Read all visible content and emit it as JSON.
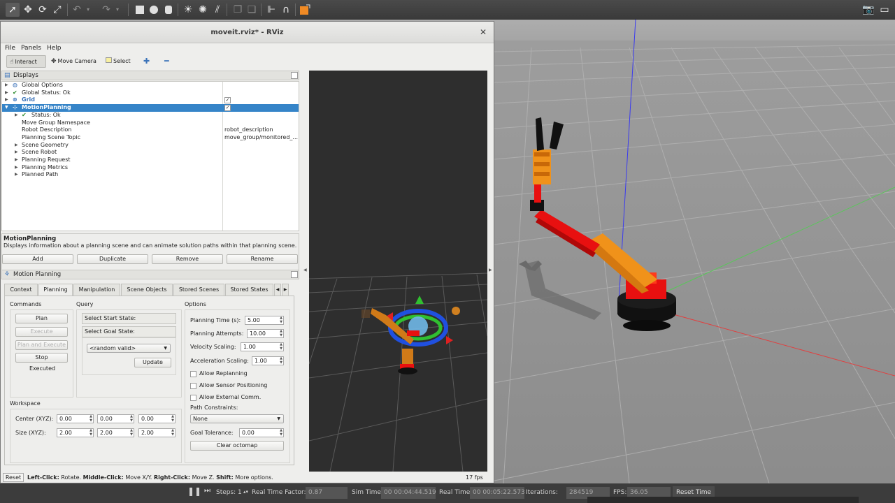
{
  "gazebo": {
    "toolbar_icons": [
      "select-arrow-icon",
      "translate-icon",
      "rotate-icon",
      "scale-icon",
      "undo-icon",
      "undo-dropdown-icon",
      "redo-icon",
      "redo-dropdown-icon",
      "box-icon",
      "sphere-icon",
      "cylinder-icon",
      "point-light-icon",
      "spot-light-icon",
      "directional-light-icon",
      "copy-icon",
      "paste-icon",
      "align-icon",
      "snap-icon",
      "change-color-icon",
      "screenshot-icon",
      "record-icon"
    ],
    "bottom": {
      "steps_label": "Steps:",
      "steps_value": "1",
      "rtf_label": "Real Time Factor:",
      "rtf_value": "0.87",
      "sim_time_label": "Sim Time:",
      "sim_time_value": "00 00:04:44.519",
      "real_time_label": "Real Time:",
      "real_time_value": "00 00:05:22.573",
      "iterations_label": "Iterations:",
      "iterations_value": "284519",
      "fps_label": "FPS:",
      "fps_value": "36.05",
      "reset_time": "Reset Time"
    }
  },
  "rviz": {
    "title": "moveit.rviz* - RViz",
    "menu": {
      "file": "File",
      "panels": "Panels",
      "help": "Help"
    },
    "tools": {
      "interact": "Interact",
      "move_camera": "Move Camera",
      "select": "Select"
    },
    "displays_header": "Displays",
    "tree": [
      {
        "label": "Global Options",
        "value": ""
      },
      {
        "label": "Global Status: Ok",
        "value": ""
      },
      {
        "label": "Grid",
        "value": ""
      },
      {
        "label": "MotionPlanning",
        "value": ""
      },
      {
        "label": "Status: Ok",
        "value": ""
      },
      {
        "label": "Move Group Namespace",
        "value": ""
      },
      {
        "label": "Robot Description",
        "value": "robot_description"
      },
      {
        "label": "Planning Scene Topic",
        "value": "move_group/monitored_..."
      },
      {
        "label": "Scene Geometry",
        "value": ""
      },
      {
        "label": "Scene Robot",
        "value": ""
      },
      {
        "label": "Planning Request",
        "value": ""
      },
      {
        "label": "Planning Metrics",
        "value": ""
      },
      {
        "label": "Planned Path",
        "value": ""
      }
    ],
    "description": {
      "title": "MotionPlanning",
      "text": "Displays information about a planning scene and can animate solution paths within that planning scene."
    },
    "display_buttons": {
      "add": "Add",
      "duplicate": "Duplicate",
      "remove": "Remove",
      "rename": "Rename"
    },
    "motion_planning_header": "Motion Planning",
    "tabs": [
      "Context",
      "Planning",
      "Manipulation",
      "Scene Objects",
      "Stored Scenes",
      "Stored States"
    ],
    "active_tab": "Planning",
    "commands": {
      "title": "Commands",
      "plan": "Plan",
      "execute": "Execute",
      "plan_and_execute": "Plan and Execute",
      "stop": "Stop",
      "status": "Executed"
    },
    "query": {
      "title": "Query",
      "start_state": "Select Start State:",
      "goal_state": "Select Goal State:",
      "goal_choice": "<random valid>",
      "update": "Update"
    },
    "options": {
      "title": "Options",
      "planning_time_label": "Planning Time (s):",
      "planning_time": "5.00",
      "planning_attempts_label": "Planning Attempts:",
      "planning_attempts": "10.00",
      "velocity_scaling_label": "Velocity Scaling:",
      "velocity_scaling": "1.00",
      "acceleration_scaling_label": "Acceleration Scaling:",
      "acceleration_scaling": "1.00",
      "allow_replanning": "Allow Replanning",
      "allow_sensor_positioning": "Allow Sensor Positioning",
      "allow_external_comm": "Allow External Comm.",
      "path_constraints_label": "Path Constraints:",
      "path_constraints": "None",
      "goal_tolerance_label": "Goal Tolerance:",
      "goal_tolerance": "0.00",
      "clear_octomap": "Clear octomap"
    },
    "workspace": {
      "title": "Workspace",
      "center_label": "Center (XYZ):",
      "center": [
        "0.00",
        "0.00",
        "0.00"
      ],
      "size_label": "Size (XYZ):",
      "size": [
        "2.00",
        "2.00",
        "2.00"
      ]
    },
    "status_bar": {
      "reset": "Reset",
      "left_click_key": "Left-Click:",
      "left_click": "Rotate.",
      "middle_click_key": "Middle-Click:",
      "middle_click": "Move X/Y.",
      "right_click_key": "Right-Click:",
      "right_click": "Move Z.",
      "shift_key": "Shift:",
      "shift": "More options."
    },
    "fps": "17 fps"
  }
}
